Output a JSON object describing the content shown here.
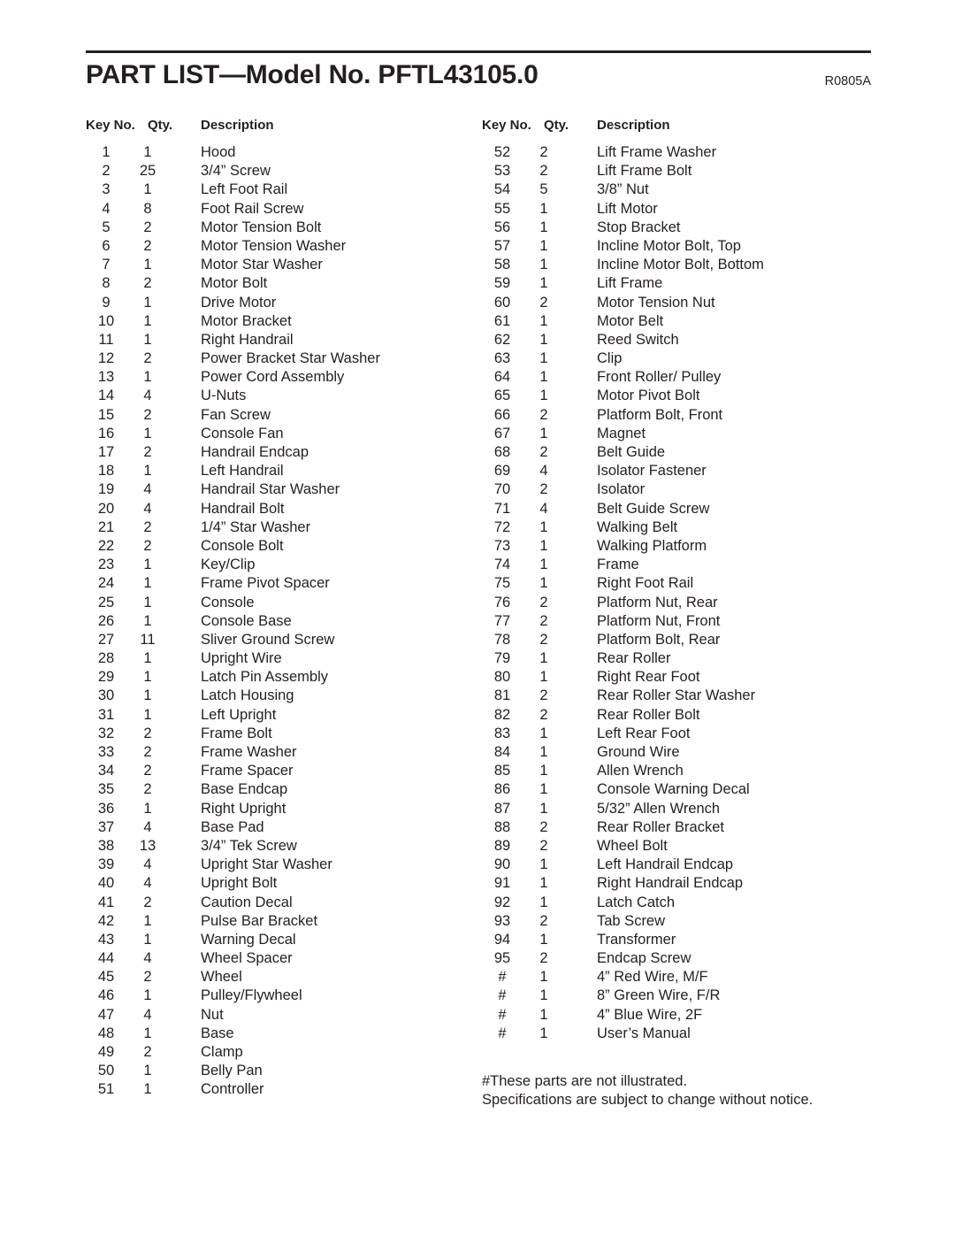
{
  "header": {
    "title": "PART LIST—Model No. PFTL43105.0",
    "revision": "R0805A"
  },
  "table": {
    "headers": {
      "key_no": "Key No.",
      "qty": "Qty.",
      "description": "Description"
    },
    "left_column": [
      {
        "key": "1",
        "qty": "1",
        "description": "Hood"
      },
      {
        "key": "2",
        "qty": "25",
        "description": "3/4” Screw"
      },
      {
        "key": "3",
        "qty": "1",
        "description": "Left Foot Rail"
      },
      {
        "key": "4",
        "qty": "8",
        "description": "Foot Rail Screw"
      },
      {
        "key": "5",
        "qty": "2",
        "description": "Motor Tension Bolt"
      },
      {
        "key": "6",
        "qty": "2",
        "description": "Motor Tension Washer"
      },
      {
        "key": "7",
        "qty": "1",
        "description": "Motor Star Washer"
      },
      {
        "key": "8",
        "qty": "2",
        "description": "Motor Bolt"
      },
      {
        "key": "9",
        "qty": "1",
        "description": "Drive Motor"
      },
      {
        "key": "10",
        "qty": "1",
        "description": "Motor Bracket"
      },
      {
        "key": "11",
        "qty": "1",
        "description": "Right Handrail"
      },
      {
        "key": "12",
        "qty": "2",
        "description": "Power Bracket Star Washer"
      },
      {
        "key": "13",
        "qty": "1",
        "description": "Power Cord Assembly"
      },
      {
        "key": "14",
        "qty": "4",
        "description": "U-Nuts"
      },
      {
        "key": "15",
        "qty": "2",
        "description": "Fan Screw"
      },
      {
        "key": "16",
        "qty": "1",
        "description": "Console Fan"
      },
      {
        "key": "17",
        "qty": "2",
        "description": "Handrail Endcap"
      },
      {
        "key": "18",
        "qty": "1",
        "description": "Left Handrail"
      },
      {
        "key": "19",
        "qty": "4",
        "description": "Handrail Star Washer"
      },
      {
        "key": "20",
        "qty": "4",
        "description": "Handrail Bolt"
      },
      {
        "key": "21",
        "qty": "2",
        "description": "1/4” Star Washer"
      },
      {
        "key": "22",
        "qty": "2",
        "description": "Console Bolt"
      },
      {
        "key": "23",
        "qty": "1",
        "description": "Key/Clip"
      },
      {
        "key": "24",
        "qty": "1",
        "description": "Frame Pivot Spacer"
      },
      {
        "key": "25",
        "qty": "1",
        "description": "Console"
      },
      {
        "key": "26",
        "qty": "1",
        "description": "Console Base"
      },
      {
        "key": "27",
        "qty": "11",
        "description": "Sliver Ground Screw"
      },
      {
        "key": "28",
        "qty": "1",
        "description": "Upright Wire"
      },
      {
        "key": "29",
        "qty": "1",
        "description": "Latch Pin Assembly"
      },
      {
        "key": "30",
        "qty": "1",
        "description": "Latch Housing"
      },
      {
        "key": "31",
        "qty": "1",
        "description": "Left Upright"
      },
      {
        "key": "32",
        "qty": "2",
        "description": "Frame Bolt"
      },
      {
        "key": "33",
        "qty": "2",
        "description": "Frame Washer"
      },
      {
        "key": "34",
        "qty": "2",
        "description": "Frame Spacer"
      },
      {
        "key": "35",
        "qty": "2",
        "description": "Base Endcap"
      },
      {
        "key": "36",
        "qty": "1",
        "description": "Right Upright"
      },
      {
        "key": "37",
        "qty": "4",
        "description": "Base Pad"
      },
      {
        "key": "38",
        "qty": "13",
        "description": "3/4” Tek Screw"
      },
      {
        "key": "39",
        "qty": "4",
        "description": "Upright Star Washer"
      },
      {
        "key": "40",
        "qty": "4",
        "description": "Upright Bolt"
      },
      {
        "key": "41",
        "qty": "2",
        "description": "Caution Decal"
      },
      {
        "key": "42",
        "qty": "1",
        "description": "Pulse Bar Bracket"
      },
      {
        "key": "43",
        "qty": "1",
        "description": "Warning Decal"
      },
      {
        "key": "44",
        "qty": "4",
        "description": "Wheel Spacer"
      },
      {
        "key": "45",
        "qty": "2",
        "description": "Wheel"
      },
      {
        "key": "46",
        "qty": "1",
        "description": "Pulley/Flywheel"
      },
      {
        "key": "47",
        "qty": "4",
        "description": "Nut"
      },
      {
        "key": "48",
        "qty": "1",
        "description": "Base"
      },
      {
        "key": "49",
        "qty": "2",
        "description": "Clamp"
      },
      {
        "key": "50",
        "qty": "1",
        "description": "Belly Pan"
      },
      {
        "key": "51",
        "qty": "1",
        "description": "Controller"
      }
    ],
    "right_column": [
      {
        "key": "52",
        "qty": "2",
        "description": "Lift Frame Washer"
      },
      {
        "key": "53",
        "qty": "2",
        "description": "Lift Frame Bolt"
      },
      {
        "key": "54",
        "qty": "5",
        "description": "3/8” Nut"
      },
      {
        "key": "55",
        "qty": "1",
        "description": "Lift Motor"
      },
      {
        "key": "56",
        "qty": "1",
        "description": "Stop Bracket"
      },
      {
        "key": "57",
        "qty": "1",
        "description": "Incline Motor Bolt, Top"
      },
      {
        "key": "58",
        "qty": "1",
        "description": "Incline Motor Bolt, Bottom"
      },
      {
        "key": "59",
        "qty": "1",
        "description": "Lift Frame"
      },
      {
        "key": "60",
        "qty": "2",
        "description": "Motor Tension Nut"
      },
      {
        "key": "61",
        "qty": "1",
        "description": "Motor Belt"
      },
      {
        "key": "62",
        "qty": "1",
        "description": "Reed Switch"
      },
      {
        "key": "63",
        "qty": "1",
        "description": "Clip"
      },
      {
        "key": "64",
        "qty": "1",
        "description": "Front Roller/ Pulley"
      },
      {
        "key": "65",
        "qty": "1",
        "description": "Motor Pivot Bolt"
      },
      {
        "key": "66",
        "qty": "2",
        "description": "Platform Bolt, Front"
      },
      {
        "key": "67",
        "qty": "1",
        "description": "Magnet"
      },
      {
        "key": "68",
        "qty": "2",
        "description": "Belt Guide"
      },
      {
        "key": "69",
        "qty": "4",
        "description": "Isolator Fastener"
      },
      {
        "key": "70",
        "qty": "2",
        "description": "Isolator"
      },
      {
        "key": "71",
        "qty": "4",
        "description": "Belt Guide Screw"
      },
      {
        "key": "72",
        "qty": "1",
        "description": "Walking Belt"
      },
      {
        "key": "73",
        "qty": "1",
        "description": "Walking Platform"
      },
      {
        "key": "74",
        "qty": "1",
        "description": "Frame"
      },
      {
        "key": "75",
        "qty": "1",
        "description": "Right Foot Rail"
      },
      {
        "key": "76",
        "qty": "2",
        "description": "Platform Nut, Rear"
      },
      {
        "key": "77",
        "qty": "2",
        "description": "Platform Nut, Front"
      },
      {
        "key": "78",
        "qty": "2",
        "description": "Platform Bolt, Rear"
      },
      {
        "key": "79",
        "qty": "1",
        "description": "Rear Roller"
      },
      {
        "key": "80",
        "qty": "1",
        "description": "Right Rear Foot"
      },
      {
        "key": "81",
        "qty": "2",
        "description": "Rear Roller Star Washer"
      },
      {
        "key": "82",
        "qty": "2",
        "description": "Rear Roller Bolt"
      },
      {
        "key": "83",
        "qty": "1",
        "description": "Left Rear Foot"
      },
      {
        "key": "84",
        "qty": "1",
        "description": "Ground Wire"
      },
      {
        "key": "85",
        "qty": "1",
        "description": "Allen Wrench"
      },
      {
        "key": "86",
        "qty": "1",
        "description": "Console Warning Decal"
      },
      {
        "key": "87",
        "qty": "1",
        "description": "5/32” Allen Wrench"
      },
      {
        "key": "88",
        "qty": "2",
        "description": "Rear Roller Bracket"
      },
      {
        "key": "89",
        "qty": "2",
        "description": "Wheel Bolt"
      },
      {
        "key": "90",
        "qty": "1",
        "description": "Left Handrail Endcap"
      },
      {
        "key": "91",
        "qty": "1",
        "description": "Right Handrail Endcap"
      },
      {
        "key": "92",
        "qty": "1",
        "description": "Latch Catch"
      },
      {
        "key": "93",
        "qty": "2",
        "description": "Tab Screw"
      },
      {
        "key": "94",
        "qty": "1",
        "description": "Transformer"
      },
      {
        "key": "95",
        "qty": "2",
        "description": "Endcap Screw"
      },
      {
        "key": "#",
        "qty": "1",
        "description": "4” Red Wire, M/F"
      },
      {
        "key": "#",
        "qty": "1",
        "description": "8” Green Wire, F/R"
      },
      {
        "key": "#",
        "qty": "1",
        "description": "4” Blue Wire, 2F"
      },
      {
        "key": "#",
        "qty": "1",
        "description": "User’s Manual"
      }
    ]
  },
  "footnotes": [
    "#These parts are not illustrated.",
    "Specifications are subject to change without notice."
  ]
}
